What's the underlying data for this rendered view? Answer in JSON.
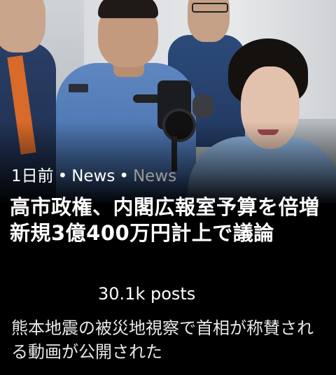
{
  "story": {
    "age": "1日前",
    "separator": "•",
    "category_primary": "News",
    "category_secondary": "News",
    "headline": "高市政権、内閣広報室予算を倍増 新規3億400万円計上で議論",
    "post_count": "30.1k posts",
    "subtitle": "熊本地震の被災地視察で首相が称賛される動画が公開された"
  },
  "colors": {
    "background": "#000000",
    "text_primary": "#ffffff",
    "text_muted": "#9a9a9a"
  }
}
